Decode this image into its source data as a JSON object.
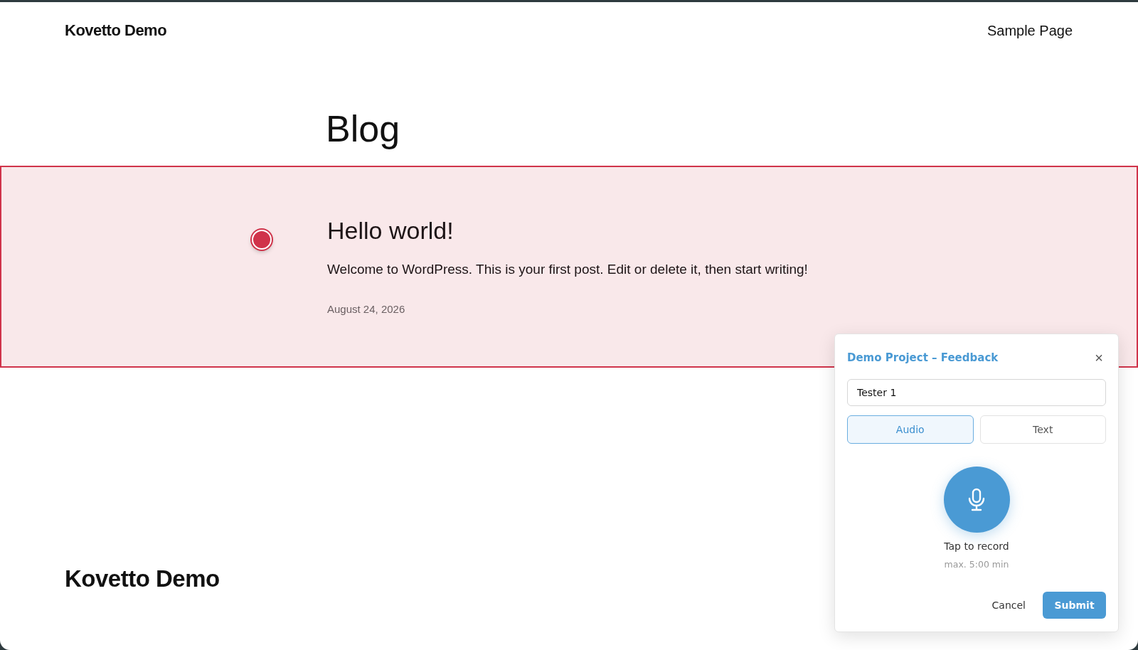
{
  "header": {
    "site_title": "Kovetto Demo",
    "nav": [
      "Sample Page"
    ]
  },
  "page_title": "Blog",
  "post": {
    "highlighted": true,
    "title": "Hello world!",
    "excerpt": "Welcome to WordPress. This is your first post. Edit or delete it, then start writing!",
    "date": "August 24, 2026"
  },
  "footer": {
    "site_title": "Kovetto Demo"
  },
  "feedback_panel": {
    "title": "Demo Project – Feedback",
    "close": "×",
    "name_field": {
      "value": "Tester 1"
    },
    "tabs": [
      {
        "label": "Audio",
        "selected": true
      },
      {
        "label": "Text",
        "selected": false
      }
    ],
    "record_label": "Tap to record",
    "record_limit": "max. 5:00 min",
    "buttons": [
      {
        "label": "Cancel",
        "kind": "secondary"
      },
      {
        "label": "Submit",
        "kind": "primary"
      }
    ]
  }
}
